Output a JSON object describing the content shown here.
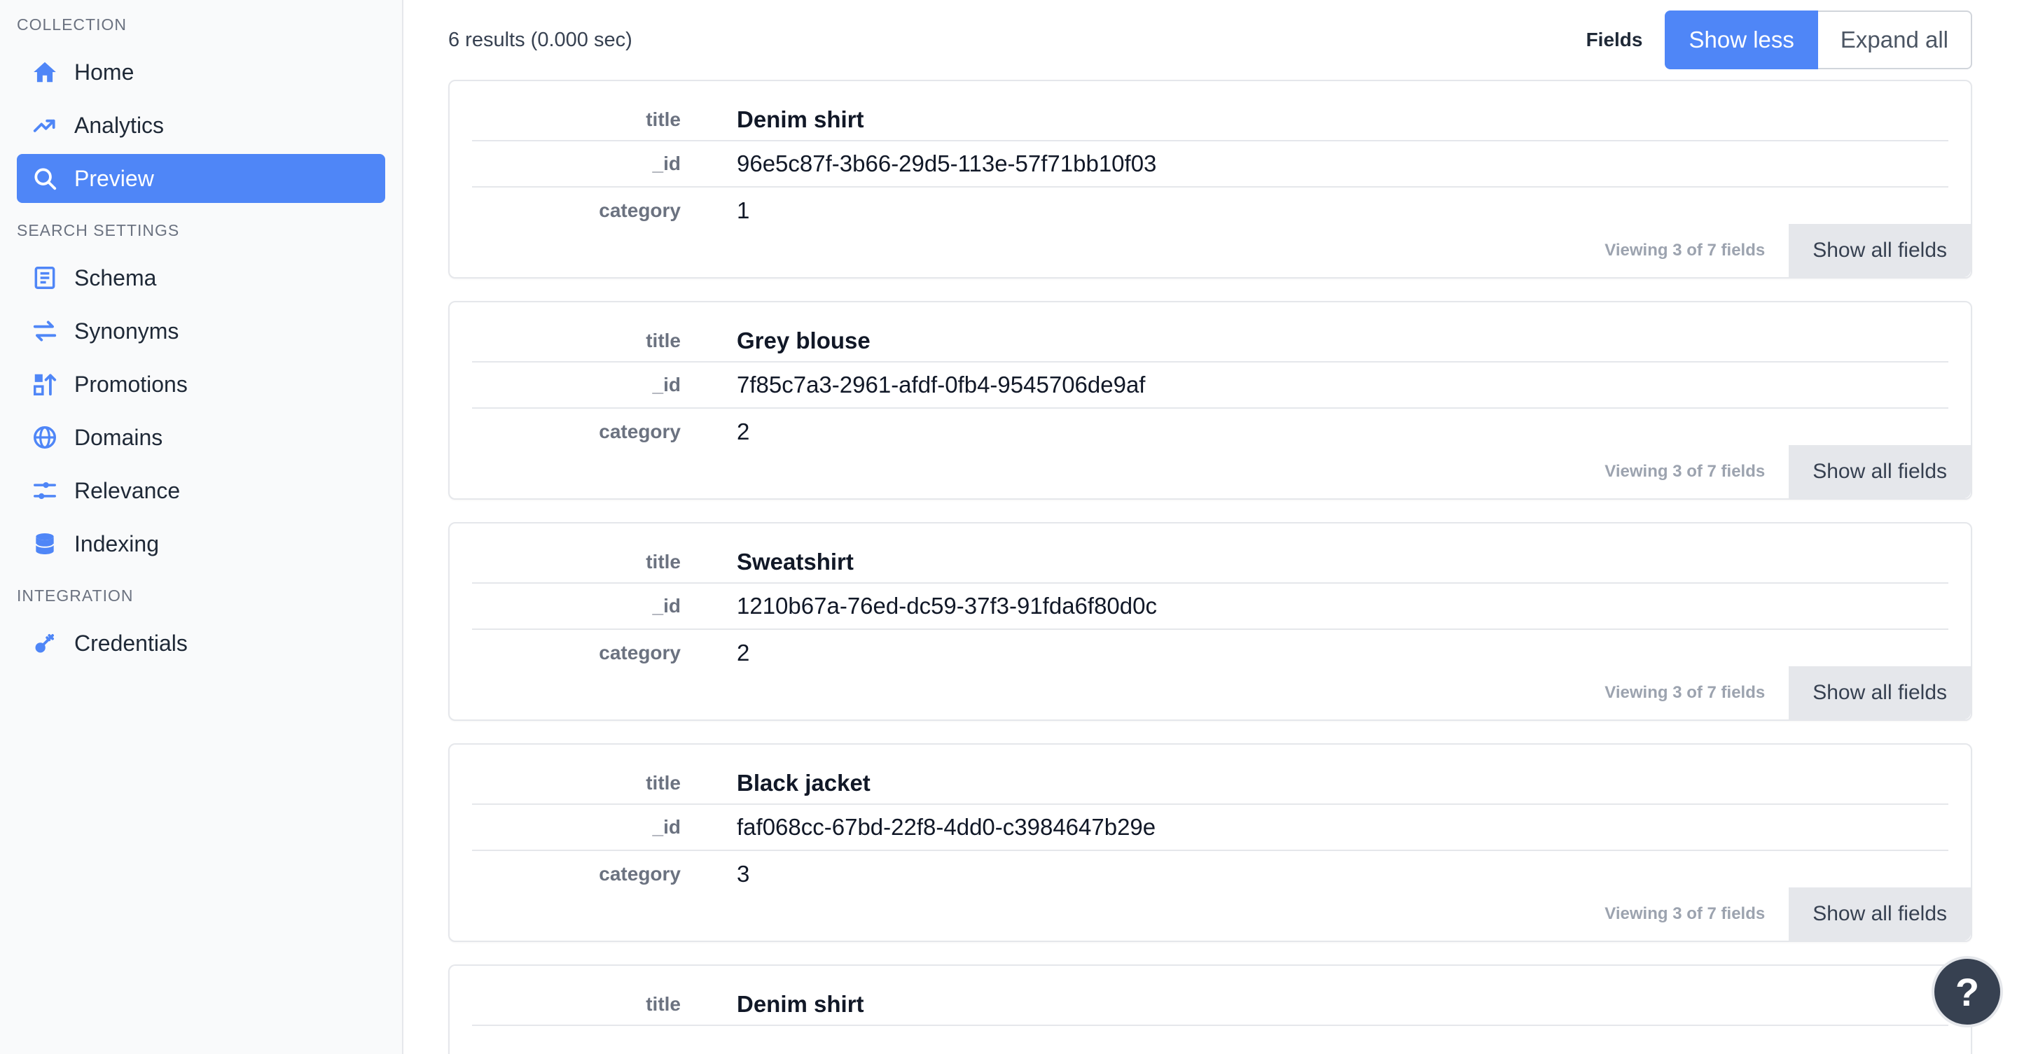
{
  "sidebar": {
    "sections": [
      {
        "title": "COLLECTION",
        "items": [
          {
            "label": "Home",
            "icon": "home-icon",
            "active": false
          },
          {
            "label": "Analytics",
            "icon": "analytics-icon",
            "active": false
          },
          {
            "label": "Preview",
            "icon": "search-icon",
            "active": true
          }
        ]
      },
      {
        "title": "SEARCH SETTINGS",
        "items": [
          {
            "label": "Schema",
            "icon": "schema-icon",
            "active": false
          },
          {
            "label": "Synonyms",
            "icon": "synonyms-icon",
            "active": false
          },
          {
            "label": "Promotions",
            "icon": "promotions-icon",
            "active": false
          },
          {
            "label": "Domains",
            "icon": "globe-icon",
            "active": false
          },
          {
            "label": "Relevance",
            "icon": "sliders-icon",
            "active": false
          },
          {
            "label": "Indexing",
            "icon": "database-icon",
            "active": false
          }
        ]
      },
      {
        "title": "INTEGRATION",
        "items": [
          {
            "label": "Credentials",
            "icon": "key-icon",
            "active": false
          }
        ]
      }
    ]
  },
  "main": {
    "results_text": "6 results (0.000 sec)",
    "fields_label": "Fields",
    "show_less_label": "Show less",
    "expand_all_label": "Expand all",
    "field_keys": {
      "title": "title",
      "id": "_id",
      "category": "category"
    },
    "results": [
      {
        "title": "Denim shirt",
        "id": "96e5c87f-3b66-29d5-113e-57f71bb10f03",
        "category": "1",
        "viewing": "Viewing 3 of 7 fields",
        "action": "Show all fields"
      },
      {
        "title": "Grey blouse",
        "id": "7f85c7a3-2961-afdf-0fb4-9545706de9af",
        "category": "2",
        "viewing": "Viewing 3 of 7 fields",
        "action": "Show all fields"
      },
      {
        "title": "Sweatshirt",
        "id": "1210b67a-76ed-dc59-37f3-91fda6f80d0c",
        "category": "2",
        "viewing": "Viewing 3 of 7 fields",
        "action": "Show all fields"
      },
      {
        "title": "Black jacket",
        "id": "faf068cc-67bd-22f8-4dd0-c3984647b29e",
        "category": "3",
        "viewing": "Viewing 3 of 7 fields",
        "action": "Show all fields"
      },
      {
        "title": "Denim shirt"
      }
    ],
    "help_label": "?"
  },
  "colors": {
    "accent": "#4f86f7",
    "sidebar_bg": "#f9fafb",
    "help_bg": "#374151"
  }
}
